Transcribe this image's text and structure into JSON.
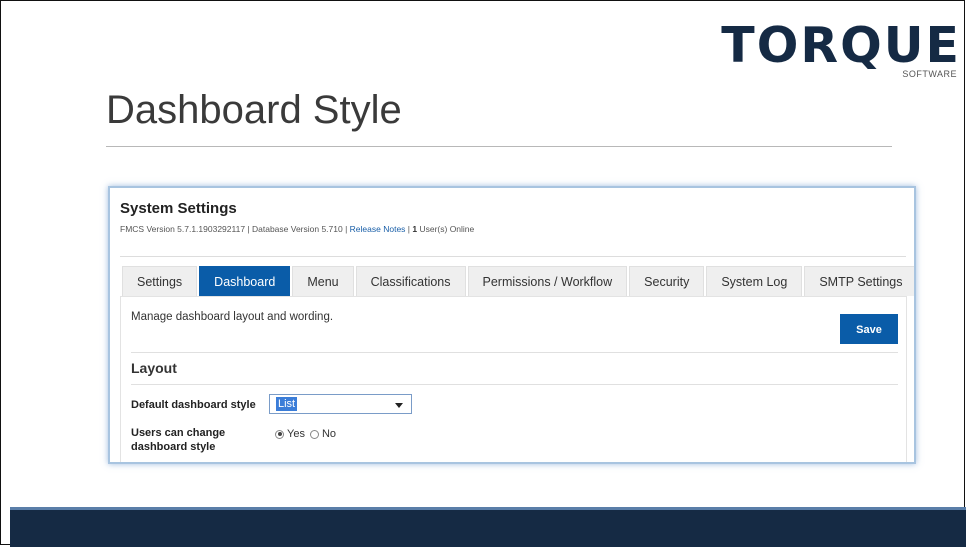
{
  "logo": {
    "word": "TORQUE",
    "sub": "SOFTWARE"
  },
  "slide": {
    "title": "Dashboard Style"
  },
  "settings": {
    "title": "System Settings",
    "version_prefix": "FMCS Version 5.7.1.1903292117 | Database Version 5.710 | ",
    "release_notes": "Release Notes",
    "separator": " | ",
    "users_count": "1",
    "users_suffix": " User(s) Online"
  },
  "tabs": [
    {
      "label": "Settings",
      "active": false
    },
    {
      "label": "Dashboard",
      "active": true
    },
    {
      "label": "Menu",
      "active": false
    },
    {
      "label": "Classifications",
      "active": false
    },
    {
      "label": "Permissions / Workflow",
      "active": false
    },
    {
      "label": "Security",
      "active": false
    },
    {
      "label": "System Log",
      "active": false
    },
    {
      "label": "SMTP Settings",
      "active": false
    }
  ],
  "panel": {
    "description": "Manage dashboard layout and wording.",
    "save_label": "Save",
    "section_title": "Layout",
    "style_label": "Default dashboard style",
    "style_value": "List",
    "users_label": "Users can change dashboard style",
    "radio_yes": "Yes",
    "radio_no": "No",
    "selected_radio": "Yes"
  },
  "colors": {
    "brand_navy": "#152a44",
    "accent_blue": "#0a5ca8",
    "link_blue": "#1a5fa8"
  }
}
